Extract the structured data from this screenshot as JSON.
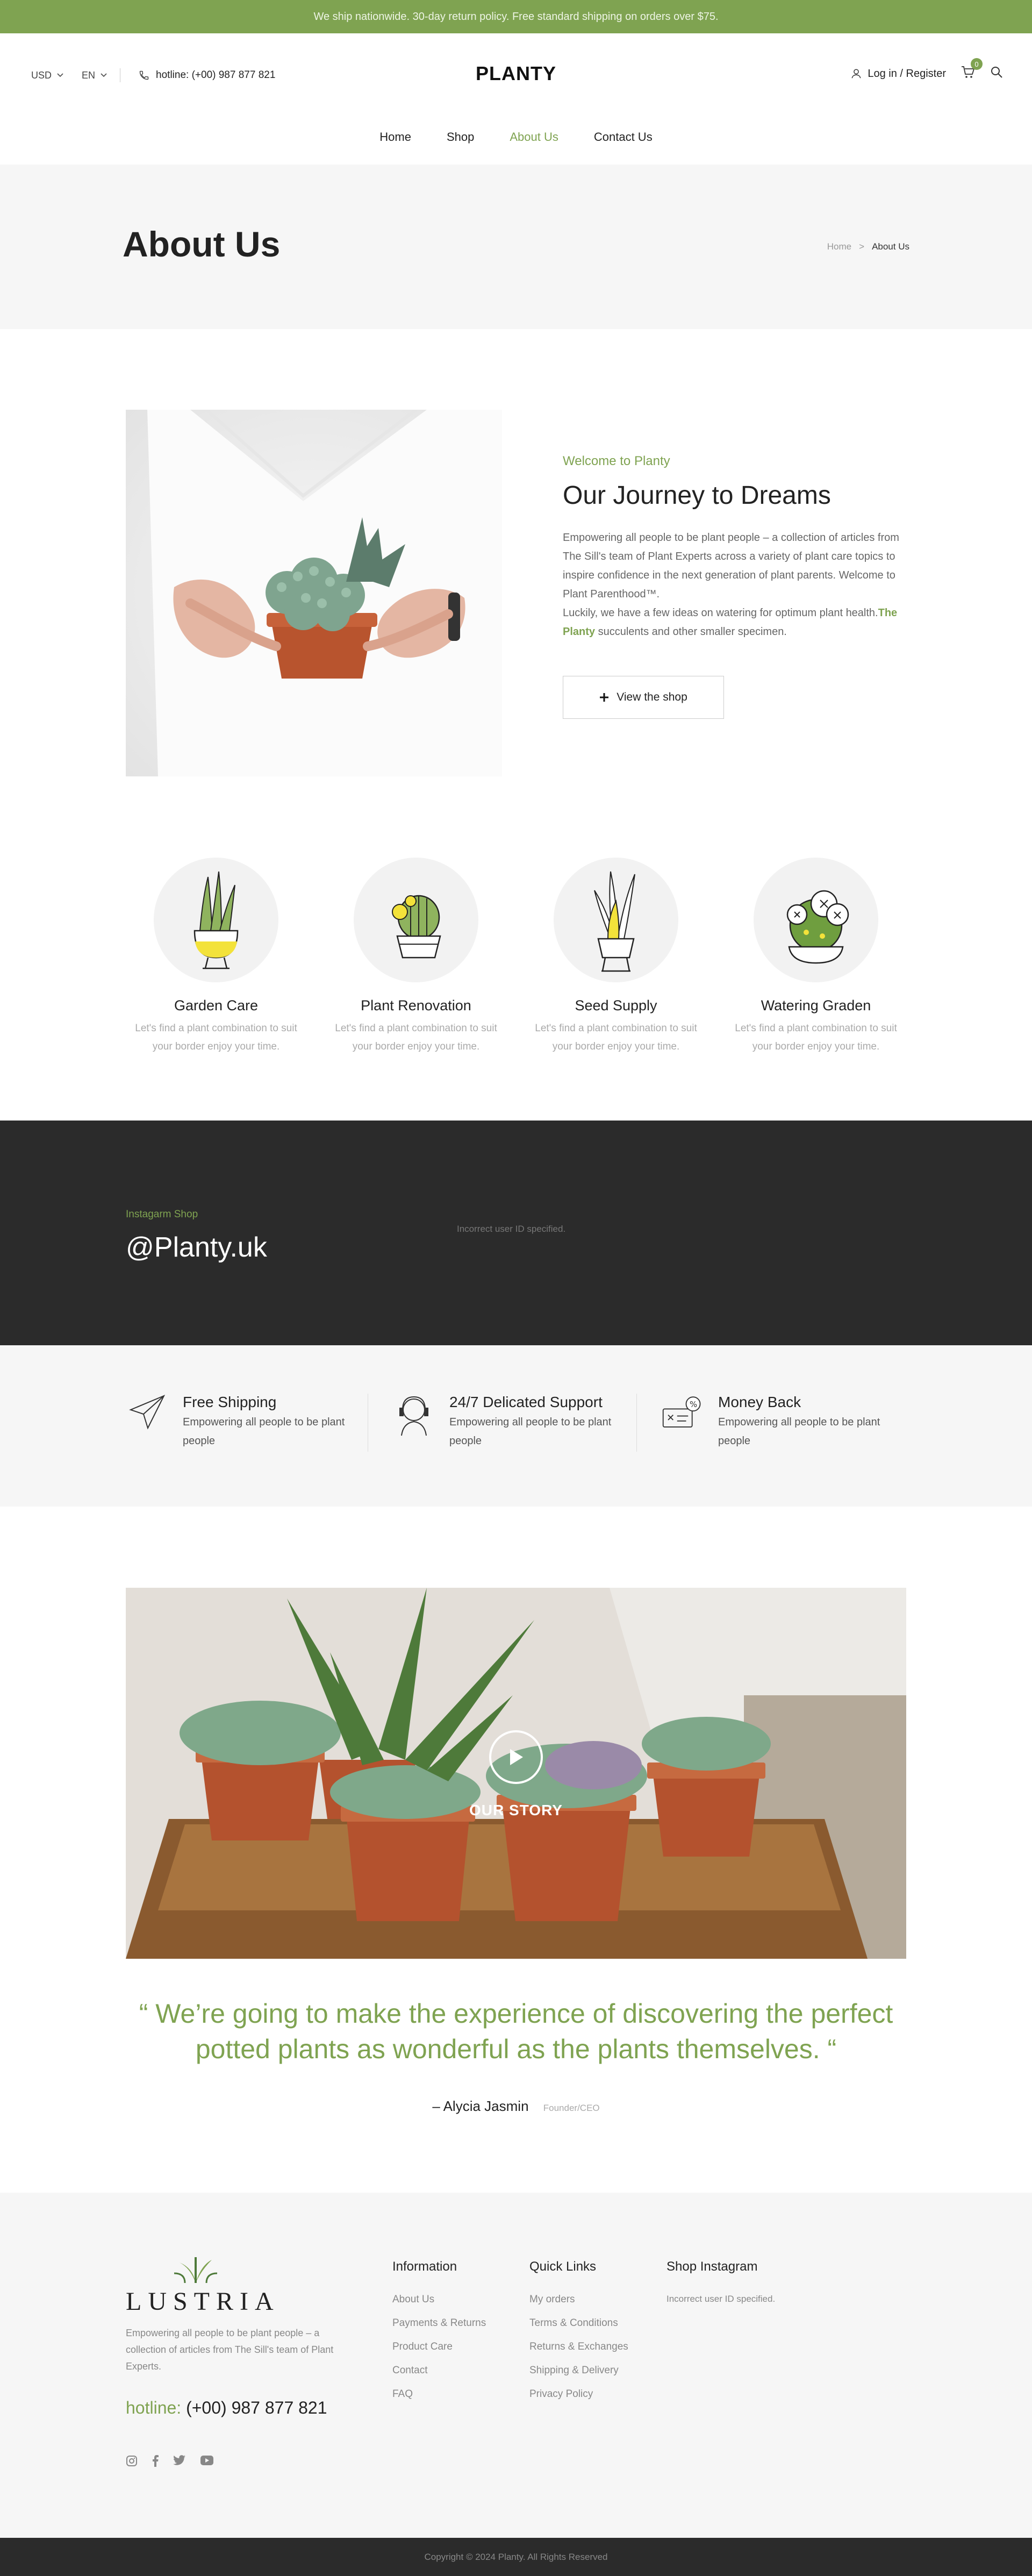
{
  "topbar": {
    "text": "We ship nationwide. 30-day return policy. Free standard shipping on orders over $75."
  },
  "header": {
    "currency": "USD",
    "language": "EN",
    "hotline": "hotline: (+00) 987 877 821",
    "logo": "PLANTY",
    "login": "Log in / Register",
    "cart_count": "0"
  },
  "nav": [
    {
      "label": "Home"
    },
    {
      "label": "Shop"
    },
    {
      "label": "About Us"
    },
    {
      "label": "Contact Us"
    }
  ],
  "page_title": {
    "title": "About Us",
    "crumb_home": "Home",
    "crumb_sep": ">",
    "crumb_current": "About Us"
  },
  "intro": {
    "kicker": "Welcome to Planty",
    "heading": "Our Journey to Dreams",
    "para1": "Empowering all people to be plant people – a collection of articles from The Sill's team of Plant Experts across a variety of plant care topics to inspire confidence in the next generation of plant parents. Welcome to Plant Parenthood™.",
    "para2_start": "Luckily, we have a few ideas on watering for optimum plant health.",
    "para2_brand": "The Planty",
    "para2_end": " succulents and other smaller specimen.",
    "button": "View the shop"
  },
  "features": [
    {
      "title": "Garden Care",
      "text": "Let's find a plant combination to suit your border enjoy your time."
    },
    {
      "title": "Plant Renovation",
      "text": "Let's find a plant combination to suit your border enjoy your time."
    },
    {
      "title": "Seed Supply",
      "text": "Let's find a plant combination to suit your border enjoy your time."
    },
    {
      "title": "Watering Graden",
      "text": "Let's find a plant combination to suit your border enjoy your time."
    }
  ],
  "instagram": {
    "kicker": "Instagarm Shop",
    "handle": "@Planty.uk",
    "error": "Incorrect user ID specified."
  },
  "services": [
    {
      "title": "Free Shipping",
      "text": "Empowering all people to be plant people"
    },
    {
      "title": "24/7 Delicated Support",
      "text": "Empowering all people to be plant people"
    },
    {
      "title": "Money Back",
      "text": "Empowering all people to be plant people"
    }
  ],
  "story": {
    "label": "OUR STORY"
  },
  "quote": {
    "text": "“ We’re going to make the experience of discovering the perfect potted plants as wonderful as the plants themselves. “",
    "author": "– Alycia Jasmin",
    "role": "Founder/CEO"
  },
  "footer": {
    "logo": "LUSTRIA",
    "description": "Empowering all people to be plant people – a collection of articles from The Sill's team of Plant Experts.",
    "hotline_label": "hotline:",
    "hotline_number": "(+00) 987 877 821",
    "info_title": "Information",
    "info_links": [
      "About Us",
      "Payments & Returns",
      "Product Care",
      "Contact",
      "FAQ"
    ],
    "quick_title": "Quick Links",
    "quick_links": [
      "My orders",
      "Terms & Conditions",
      "Returns & Exchanges",
      "Shipping & Delivery",
      "Privacy Policy"
    ],
    "insta_title": "Shop Instagram",
    "insta_error": "Incorrect user ID specified."
  },
  "copyright": "Copyright © 2024 Planty. All Rights Reserved",
  "colors": {
    "accent": "#7fa351",
    "dark": "#2b2b2b",
    "light_bg": "#f6f6f6"
  },
  "icons": [
    "chevron-down-icon",
    "phone-icon",
    "user-icon",
    "cart-icon",
    "search-icon",
    "plus-icon",
    "paper-plane-icon",
    "support-agent-icon",
    "money-back-icon",
    "play-icon",
    "instagram-icon",
    "facebook-icon",
    "twitter-icon",
    "youtube-icon"
  ]
}
